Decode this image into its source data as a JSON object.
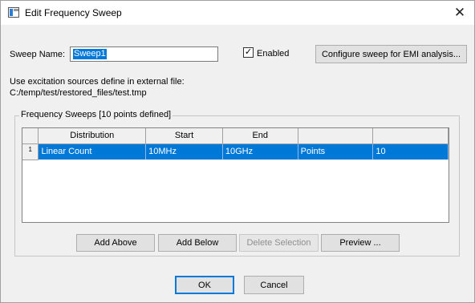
{
  "window": {
    "title": "Edit Frequency Sweep",
    "close_glyph": "✕"
  },
  "form": {
    "sweep_name_label": "Sweep Name:",
    "sweep_name_value": "Sweep1",
    "enabled_label": "Enabled",
    "enabled_checked": true,
    "check_glyph": "✓",
    "emi_button": "Configure sweep for EMI analysis...",
    "excitation_label": "Use excitation sources define in external file:",
    "excitation_path": "C:/temp/test/restored_files/test.tmp"
  },
  "sweeps": {
    "group_label": "Frequency Sweeps [10 points defined]",
    "columns": [
      "Distribution",
      "Start",
      "End",
      "",
      ""
    ],
    "rows": [
      {
        "index": "1",
        "cells": [
          "Linear Count",
          "10MHz",
          "10GHz",
          "Points",
          "10"
        ],
        "selected": true
      }
    ]
  },
  "actions": {
    "add_above": "Add Above",
    "add_below": "Add Below",
    "delete_selection": "Delete Selection",
    "preview": "Preview ..."
  },
  "footer": {
    "ok": "OK",
    "cancel": "Cancel"
  },
  "colors": {
    "selection": "#0078d7",
    "dialog_bg": "#f0f0f0"
  },
  "icons": {
    "app": "dialog-app-icon",
    "close": "close-icon"
  }
}
